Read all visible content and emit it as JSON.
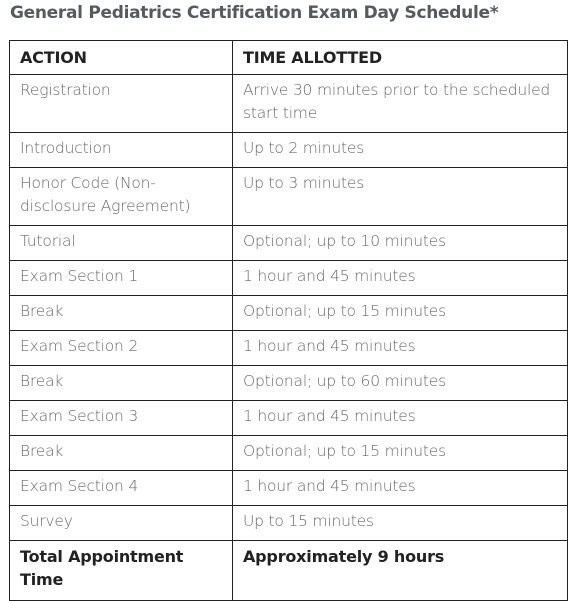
{
  "title": "General Pediatrics Certification Exam Day Schedule*",
  "table": {
    "headers": [
      "ACTION",
      "TIME ALLOTTED"
    ],
    "rows": [
      {
        "action": "Registration",
        "time": "Arrive 30 minutes prior to the scheduled start time"
      },
      {
        "action": "Introduction",
        "time": "Up to 2 minutes"
      },
      {
        "action": "Honor Code (Non-disclosure Agreement)",
        "time": "Up to 3 minutes"
      },
      {
        "action": "Tutorial",
        "time": "Optional; up to 10 minutes"
      },
      {
        "action": "Exam Section 1",
        "time": "1 hour and 45 minutes"
      },
      {
        "action": "Break",
        "time": "Optional; up to 15 minutes"
      },
      {
        "action": "Exam Section 2",
        "time": "1 hour and 45 minutes"
      },
      {
        "action": "Break",
        "time": "Optional; up to 60 minutes"
      },
      {
        "action": "Exam Section 3",
        "time": "1 hour and 45 minutes"
      },
      {
        "action": "Break",
        "time": "Optional; up to 15 minutes"
      },
      {
        "action": "Exam Section 4",
        "time": "1 hour and 45 minutes"
      },
      {
        "action": "Survey",
        "time": "Up to 15 minutes"
      }
    ],
    "total": {
      "action": "Total Appointment Time",
      "time": "Approximately 9 hours"
    }
  }
}
